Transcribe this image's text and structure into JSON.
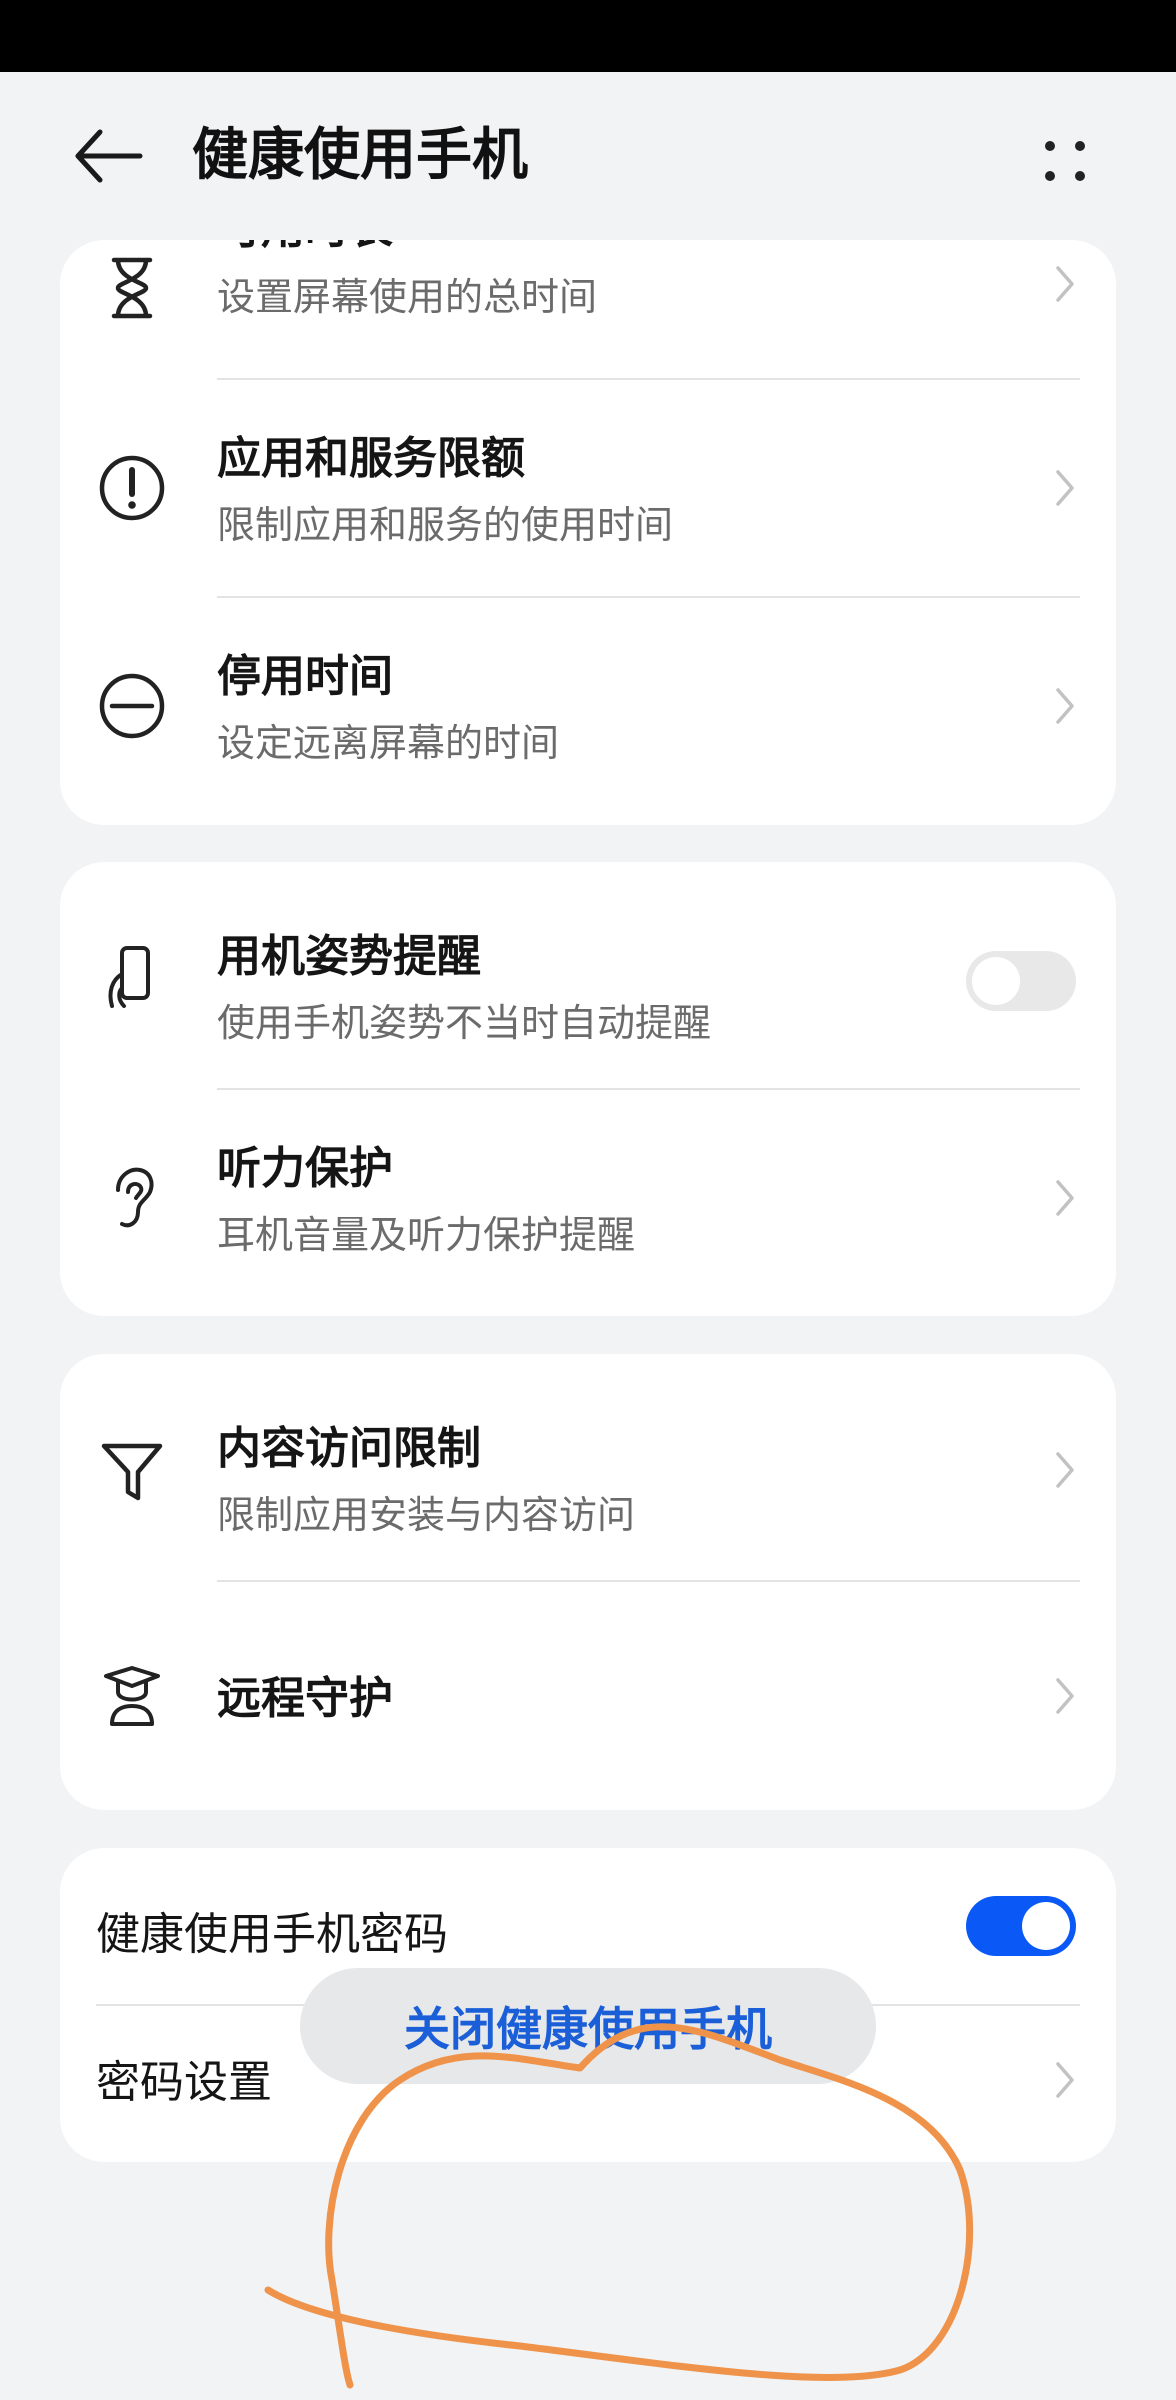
{
  "header": {
    "title": "健康使用手机"
  },
  "card1": {
    "items": [
      {
        "title": "可用时长",
        "subtitle": "设置屏幕使用的总时间"
      },
      {
        "title": "应用和服务限额",
        "subtitle": "限制应用和服务的使用时间"
      },
      {
        "title": "停用时间",
        "subtitle": "设定远离屏幕的时间"
      }
    ]
  },
  "card2": {
    "items": [
      {
        "title": "用机姿势提醒",
        "subtitle": "使用手机姿势不当时自动提醒",
        "toggle": "off"
      },
      {
        "title": "听力保护",
        "subtitle": "耳机音量及听力保护提醒"
      }
    ]
  },
  "card3": {
    "items": [
      {
        "title": "内容访问限制",
        "subtitle": "限制应用安装与内容访问"
      },
      {
        "title": "远程守护"
      }
    ]
  },
  "card4": {
    "items": [
      {
        "title": "健康使用手机密码",
        "toggle": "on"
      },
      {
        "title": "密码设置"
      }
    ]
  },
  "close_button": {
    "label": "关闭健康使用手机"
  },
  "colors": {
    "accent": "#0a59f7",
    "link_text": "#1a5fd8",
    "annotation": "#f0934a",
    "background": "#f1f3f5"
  },
  "icons": [
    "back-arrow-icon",
    "more-dots-icon",
    "hourglass-icon",
    "exclamation-circle-icon",
    "minus-circle-icon",
    "phone-hand-icon",
    "ear-icon",
    "filter-funnel-icon",
    "guardian-icon",
    "chevron-right-icon"
  ]
}
